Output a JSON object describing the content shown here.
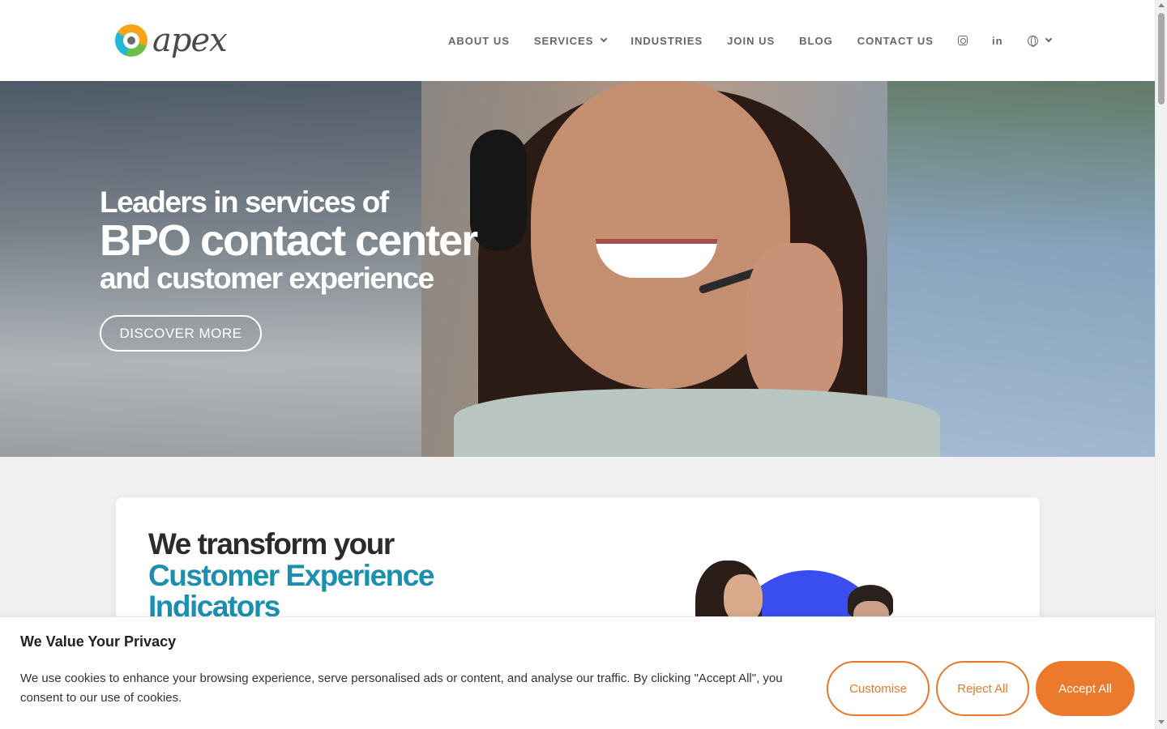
{
  "brand": {
    "name": "apex"
  },
  "nav": {
    "items": [
      {
        "label": "ABOUT US"
      },
      {
        "label": "SERVICES",
        "has_dropdown": true
      },
      {
        "label": "INDUSTRIES"
      },
      {
        "label": "JOIN US"
      },
      {
        "label": "BLOG"
      },
      {
        "label": "CONTACT US"
      }
    ],
    "linkedin_label": "in",
    "icons": [
      "instagram-icon",
      "linkedin-icon",
      "globe-icon",
      "chevron-down-icon"
    ]
  },
  "hero": {
    "line1": "Leaders in services of",
    "line2": "BPO contact center",
    "line3": "and customer experience",
    "cta_label": "DISCOVER MORE"
  },
  "intro": {
    "heading_line1": "We transform your",
    "heading_line2": "Customer Experience",
    "heading_line3": "Indicators"
  },
  "cookie": {
    "title": "We Value Your Privacy",
    "text": "We use cookies to enhance your browsing experience, serve personalised ads or content, and analyse our traffic. By clicking \"Accept All\", you consent to our use of cookies.",
    "customise_label": "Customise",
    "reject_label": "Reject All",
    "accept_label": "Accept All"
  },
  "colors": {
    "accent_orange": "#ec7a2c",
    "heading_teal": "#1b8fb0",
    "illustration_blue": "#3a4ef0"
  }
}
